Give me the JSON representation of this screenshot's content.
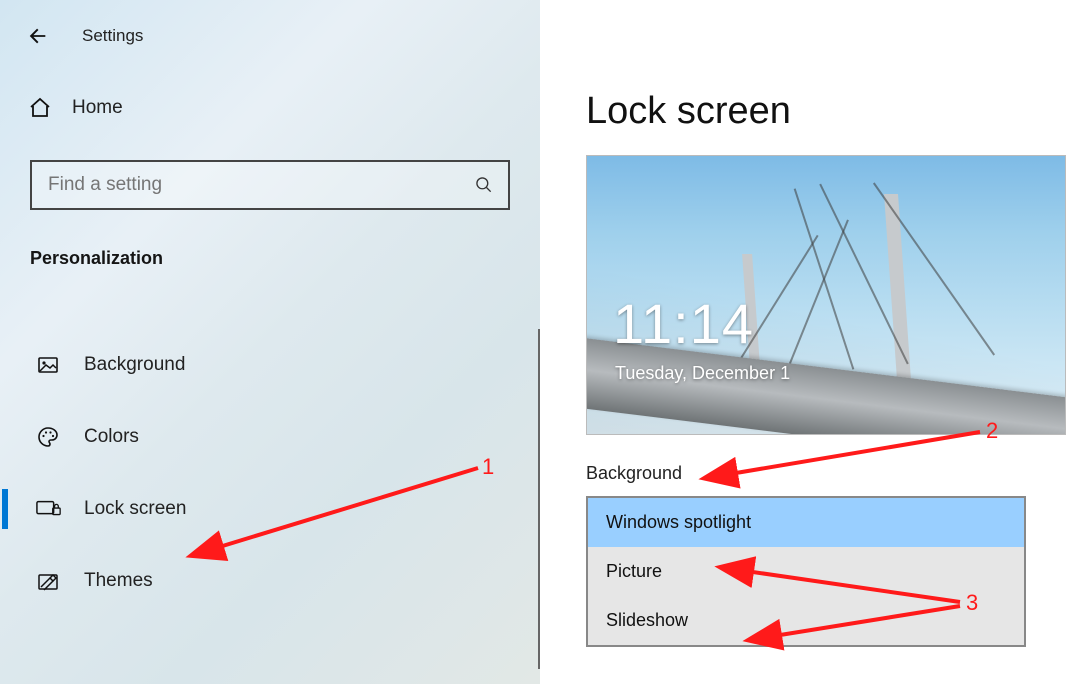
{
  "top": {
    "title": "Settings"
  },
  "home": {
    "label": "Home"
  },
  "search": {
    "placeholder": "Find a setting"
  },
  "section": "Personalization",
  "nav": {
    "items": [
      {
        "label": "Background",
        "icon": "picture-icon",
        "active": false
      },
      {
        "label": "Colors",
        "icon": "palette-icon",
        "active": false
      },
      {
        "label": "Lock screen",
        "icon": "lockscreen-icon",
        "active": true
      },
      {
        "label": "Themes",
        "icon": "pencil-icon",
        "active": false
      }
    ]
  },
  "page": {
    "title": "Lock screen",
    "preview": {
      "time": "11:14",
      "date": "Tuesday, December 1"
    },
    "background_label": "Background",
    "background_options": [
      {
        "label": "Windows spotlight",
        "selected": true
      },
      {
        "label": "Picture",
        "selected": false
      },
      {
        "label": "Slideshow",
        "selected": false
      }
    ]
  },
  "annotations": {
    "n1": "1",
    "n2": "2",
    "n3": "3"
  }
}
